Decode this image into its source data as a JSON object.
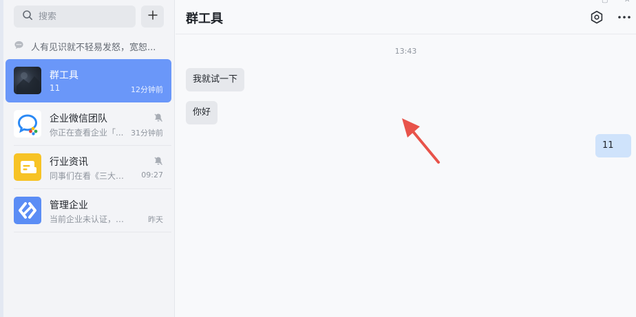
{
  "sidebar": {
    "search": {
      "placeholder": "搜索"
    },
    "notice": {
      "text": "人有见识就不轻易发怒，宽恕..."
    },
    "conversations": [
      {
        "name": "群工具",
        "preview": "11",
        "time": "12分钟前",
        "active": true,
        "avatar": "dark-photo-avatar"
      },
      {
        "name": "企业微信团队",
        "preview": "你正在查看企业「...",
        "time": "31分钟前",
        "muted": true,
        "avatar": "wecom-team-logo"
      },
      {
        "name": "行业资讯",
        "preview": "同事们在看《三大运...",
        "time": "09:27",
        "muted": true,
        "avatar": "news-icon"
      },
      {
        "name": "管理企业",
        "preview": "当前企业未认证，企业...",
        "time": "昨天",
        "avatar": "manage-icon"
      }
    ]
  },
  "chat": {
    "title": "群工具",
    "time_divider": "13:43",
    "messages": [
      {
        "direction": "incoming",
        "text": "我就试一下"
      },
      {
        "direction": "incoming",
        "text": "你好"
      },
      {
        "direction": "outgoing",
        "text": "11"
      }
    ]
  },
  "colors": {
    "accent": "#6a97f9",
    "outgoing_bubble": "#cfe3fb",
    "annotation_arrow": "#e8534a",
    "news_icon_bg": "#f7c325",
    "manage_icon_bg": "#5b8df5"
  },
  "icons": [
    "search-icon",
    "plus-icon",
    "chat-bubble-icon",
    "mute-bell-icon",
    "settings-hex-icon",
    "more-dots-icon"
  ]
}
